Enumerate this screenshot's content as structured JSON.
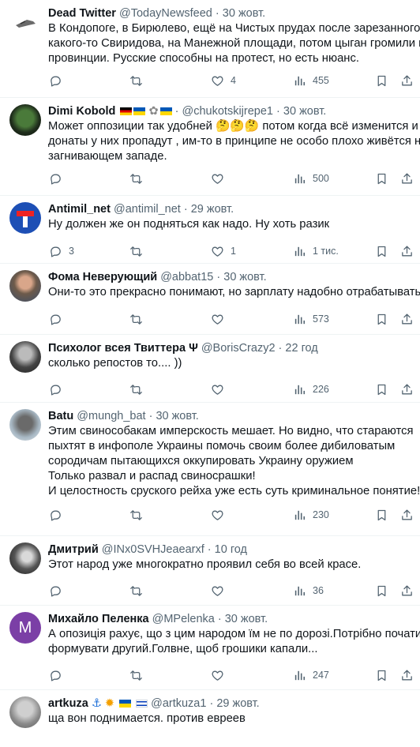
{
  "tweets": [
    {
      "name": "Dead Twitter",
      "handle": "@TodayNewsfeed",
      "time": "30 жовт.",
      "lines": [
        "В Кондопоге, в Бирюлево, ещё на Чистых прудах после зарезанного",
        "какого-то Свиридова, на Манежной площади, потом цыган громили в",
        "провинции. Русские способны на протест, но есть нюанс."
      ],
      "replies": "",
      "retweets": "",
      "likes": "4",
      "views": "455"
    },
    {
      "name": "Dimi Kobold",
      "handle": "@chukotskijrepe1",
      "time": "30 жовт.",
      "lines": [
        "Может оппозиции так удобней 🤔🤔🤔 потом когда всё изменится и",
        "донаты у них пропадут , им-то в принципе не особо плохо живётся на",
        "загнивающем западе."
      ],
      "replies": "",
      "retweets": "",
      "likes": "",
      "views": "500"
    },
    {
      "name": "Antimil_net",
      "handle": "@antimil_net",
      "time": "29 жовт.",
      "lines": [
        "Ну должен же он подняться как надо. Ну хоть разик"
      ],
      "replies": "3",
      "retweets": "",
      "likes": "1",
      "views": "1 тис."
    },
    {
      "name": "Фома Неверующий",
      "handle": "@abbat15",
      "time": "30 жовт.",
      "lines": [
        "Они-то это прекрасно понимают, но зарплату надобно отрабатывать."
      ],
      "replies": "",
      "retweets": "",
      "likes": "",
      "views": "573"
    },
    {
      "name": "Психолог всея Твиттера Ψ",
      "handle": "@BorisCrazy2",
      "time": "22 год",
      "lines": [
        "сколько репостов то.... ))"
      ],
      "replies": "",
      "retweets": "",
      "likes": "",
      "views": "226"
    },
    {
      "name": "Batu",
      "handle": "@mungh_bat",
      "time": "30 жовт.",
      "lines": [
        "Этим свиноcобакам имперскость мешает. Но видно, что стараются",
        "пыхтят в инфополе Украины помочь своим более дибиловатым",
        "сородичам пытающихся оккупировать Украину оружием",
        "Только развал и распад свиносрашки!",
        "И целостность сруского рейха уже есть суть криминальное понятие!"
      ],
      "replies": "",
      "retweets": "",
      "likes": "",
      "views": "230"
    },
    {
      "name": "Дмитрий",
      "handle": "@INx0SVHJeaearxf",
      "time": "10 год",
      "lines": [
        "Этот народ уже многократно проявил себя во всей красе."
      ],
      "replies": "",
      "retweets": "",
      "likes": "",
      "views": "36"
    },
    {
      "name": "Михайло Пеленка",
      "handle": "@MPelenka",
      "time": "30 жовт.",
      "avatar_letter": "M",
      "lines": [
        "А опозиція рахує, що з цим народом їм не по дорозі.Потрібно почати",
        "формувати другий.Голвне, щоб грошики капали..."
      ],
      "replies": "",
      "retweets": "",
      "likes": "",
      "views": "247"
    },
    {
      "name": "artkuza",
      "handle": "@artkuza1",
      "time": "29 жовт.",
      "lines": [
        "ща вон поднимается. против евреев"
      ]
    }
  ]
}
